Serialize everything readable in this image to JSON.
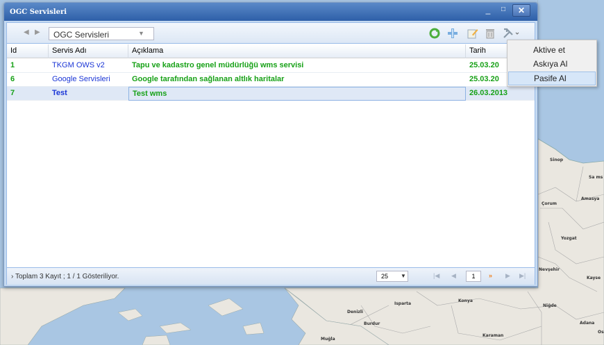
{
  "window": {
    "title": "OGC Servisleri",
    "min_glyph": "_",
    "max_glyph": "□",
    "close_glyph": "✕"
  },
  "toolbar": {
    "back_glyph": "◀",
    "fwd_glyph": "▶",
    "dropdown_value": "OGC Servisleri",
    "dropdown_arrow": "▼",
    "icons": [
      "refresh-icon",
      "add-icon",
      "edit-icon",
      "delete-icon",
      "tools-icon"
    ]
  },
  "grid": {
    "columns": [
      "Id",
      "Servis Adı",
      "Açıklama",
      "Tarih"
    ],
    "rows": [
      {
        "id": "1",
        "name": "TKGM OWS v2",
        "desc": "Tapu ve kadastro genel müdürlüğü wms servisi",
        "date": "25.03.20"
      },
      {
        "id": "6",
        "name": "Google Servisleri",
        "desc": "Google tarafından sağlanan altlık haritalar",
        "date": "25.03.20"
      },
      {
        "id": "7",
        "name": "Test",
        "desc": "Test wms",
        "date": "26.03.2013"
      }
    ]
  },
  "paging": {
    "info": "Toplam 3 Kayıt ; 1 / 1 Gösteriliyor.",
    "info_prefix": "›",
    "page_size": "25",
    "page_number": "1",
    "first_glyph": "|◀",
    "prev_glyph": "◀",
    "next_glyph": "»",
    "next2_glyph": "▶",
    "last_glyph": "▶|"
  },
  "menu": {
    "items": [
      "Aktive et",
      "Askıya Al",
      "Pasife Al"
    ],
    "active_index": 2
  },
  "map": {
    "cities": [
      "Sinop",
      "Sa ms",
      "Çorum",
      "Amasya",
      "Yozgat",
      "Nevşehir",
      "Kayse",
      "Konya",
      "Isparta",
      "Denizli",
      "Burdur",
      "Niğde",
      "Adana",
      "Karaman",
      "Muğla",
      "Os"
    ],
    "sea_color": "#a9c6e3",
    "land_color": "#eae7e0"
  }
}
